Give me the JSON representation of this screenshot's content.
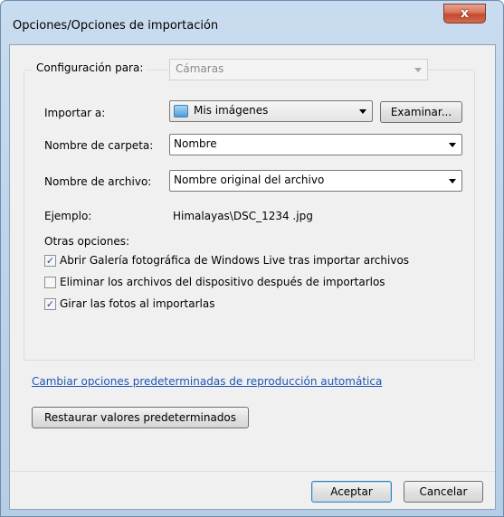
{
  "window": {
    "title": "Opciones/Opciones de importación",
    "close_glyph": "x"
  },
  "settings": {
    "config_label": "Configuración para:",
    "config_value": "Cámaras",
    "import_to_label": "Importar a:",
    "import_to_value": "Mis imágenes",
    "browse_button": "Examinar...",
    "folder_name_label": "Nombre de carpeta:",
    "folder_name_value": "Nombre",
    "file_name_label": "Nombre de archivo:",
    "file_name_value": "Nombre original del archivo",
    "example_label": "Ejemplo:",
    "example_value": "Himalayas\\DSC_1234 .jpg",
    "other_options_label": "Otras opciones:"
  },
  "options": [
    {
      "label": "Abrir Galería fotográfica de Windows Live tras importar archivos",
      "checked": true
    },
    {
      "label": "Eliminar los archivos del dispositivo después de importarlos",
      "checked": false
    },
    {
      "label": "Girar las fotos al importarlas",
      "checked": true
    }
  ],
  "autoplay_link": "Cambiar opciones predeterminadas de reproducción automática",
  "restore_button": "Restaurar valores predeterminados",
  "footer": {
    "ok_button": "Aceptar",
    "cancel_button": "Cancelar"
  },
  "icons": {
    "close": "close-icon",
    "folder": "pictures-folder-icon",
    "dropdown": "chevron-down-icon",
    "check": "checkmark-icon"
  }
}
